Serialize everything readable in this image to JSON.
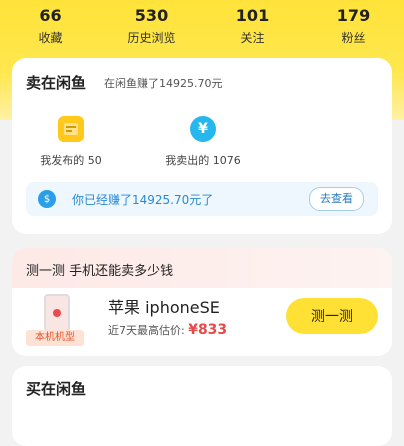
{
  "stats": [
    {
      "num": "66",
      "label": "收藏"
    },
    {
      "num": "530",
      "label": "历史浏览"
    },
    {
      "num": "101",
      "label": "关注"
    },
    {
      "num": "179",
      "label": "粉丝"
    }
  ],
  "sell": {
    "title": "卖在闲鱼",
    "subtitle": "在闲鱼赚了14925.70元",
    "published_label": "我发布的 50",
    "sold_label": "我卖出的 1076",
    "earned_text": "你已经赚了14925.70元了",
    "view_button": "去查看",
    "icons": {
      "published": "document-icon",
      "sold": "yen-icon",
      "earned": "money-bag-icon"
    },
    "colors": {
      "published": "#ffc81a",
      "sold": "#27b7ef"
    }
  },
  "price_check": {
    "title": "测一测 手机还能卖多少钱",
    "phone_tag": "本机机型",
    "phone_name": "苹果 iphoneSE",
    "price_prefix": "近7天最高估价: ",
    "price_value": "¥833",
    "button": "测一测"
  },
  "buy": {
    "title": "买在闲鱼"
  }
}
